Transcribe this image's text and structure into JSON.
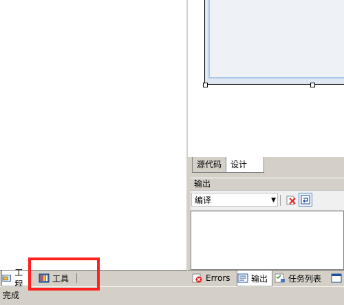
{
  "left_tabs": [
    {
      "label": "工程",
      "icon": "project-icon"
    },
    {
      "label": "工具",
      "icon": "toolbox-icon"
    }
  ],
  "view_tabs": {
    "source": "源代码",
    "design": "设计"
  },
  "output": {
    "title": "输出",
    "source_select": "编译"
  },
  "bottom_tabs": [
    {
      "label": "Errors",
      "icon": "error-icon"
    },
    {
      "label": "输出",
      "icon": "output-icon"
    },
    {
      "label": "任务列表",
      "icon": "task-list-icon"
    }
  ],
  "status": {
    "text": "完成"
  },
  "colors": {
    "highlight": "#ff2020",
    "form_border": "#a9c7e8"
  }
}
